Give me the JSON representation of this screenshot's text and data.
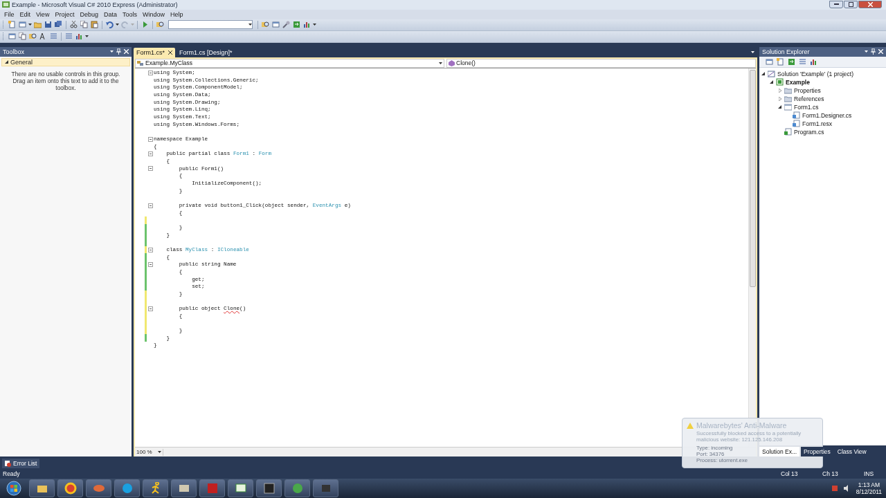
{
  "window": {
    "title": "Example - Microsoft Visual C# 2010 Express (Administrator)"
  },
  "menu": [
    "File",
    "Edit",
    "View",
    "Project",
    "Debug",
    "Data",
    "Tools",
    "Window",
    "Help"
  ],
  "toolbox": {
    "title": "Toolbox",
    "group": {
      "label": "General",
      "expanded": true
    },
    "empty_text": "There are no usable controls in this group. Drag an item onto this text to add it to the toolbox."
  },
  "editor": {
    "tabs": [
      {
        "label": "Form1.cs*",
        "selected": true
      },
      {
        "label": "Form1.cs [Design]*",
        "selected": false
      }
    ],
    "type_dropdown": "Example.MyClass",
    "member_dropdown": "Clone()",
    "zoom": "100 %",
    "lines": [
      {
        "fold": true,
        "segments": [
          {
            "text": "using System;",
            "kind": "plain"
          }
        ]
      },
      {
        "segments": [
          {
            "text": "using System.Collections.Generic;",
            "kind": "plain"
          }
        ]
      },
      {
        "segments": [
          {
            "text": "using System.ComponentModel;",
            "kind": "plain"
          }
        ]
      },
      {
        "segments": [
          {
            "text": "using System.Data;",
            "kind": "plain"
          }
        ]
      },
      {
        "segments": [
          {
            "text": "using System.Drawing;",
            "kind": "plain"
          }
        ]
      },
      {
        "segments": [
          {
            "text": "using System.Linq;",
            "kind": "plain"
          }
        ]
      },
      {
        "segments": [
          {
            "text": "using System.Text;",
            "kind": "plain"
          }
        ]
      },
      {
        "segments": [
          {
            "text": "using System.Windows.Forms;",
            "kind": "plain"
          }
        ]
      },
      {
        "fold": true,
        "blank_before": true,
        "segments": [
          {
            "text": "namespace Example",
            "kind": "plain"
          }
        ]
      },
      {
        "segments": [
          {
            "text": "{",
            "kind": "plain"
          }
        ]
      },
      {
        "fold": true,
        "segments": [
          {
            "text": "    public partial class ",
            "kind": "plain"
          },
          {
            "text": "Form1",
            "kind": "type"
          },
          {
            "text": " : ",
            "kind": "plain"
          },
          {
            "text": "Form",
            "kind": "type"
          }
        ]
      },
      {
        "segments": [
          {
            "text": "    {",
            "kind": "plain"
          }
        ]
      },
      {
        "fold": true,
        "segments": [
          {
            "text": "        public Form1()",
            "kind": "plain"
          }
        ]
      },
      {
        "segments": [
          {
            "text": "        {",
            "kind": "plain"
          }
        ]
      },
      {
        "segments": [
          {
            "text": "            InitializeComponent();",
            "kind": "plain"
          }
        ]
      },
      {
        "segments": [
          {
            "text": "        }",
            "kind": "plain"
          }
        ]
      },
      {
        "fold": true,
        "blank_before": true,
        "segments": [
          {
            "text": "        private void button1_Click(object sender, ",
            "kind": "plain"
          },
          {
            "text": "EventArgs",
            "kind": "type"
          },
          {
            "text": " e)",
            "kind": "plain"
          }
        ]
      },
      {
        "segments": [
          {
            "text": "        {",
            "kind": "plain"
          }
        ]
      },
      {
        "modified": true,
        "saved": false
      },
      {
        "modified": true,
        "saved": true,
        "segments": [
          {
            "text": "        }",
            "kind": "plain"
          }
        ]
      },
      {
        "modified": true,
        "saved": true,
        "segments": [
          {
            "text": "    }",
            "kind": "plain"
          }
        ]
      },
      {
        "modified": true,
        "saved": true
      },
      {
        "fold": true,
        "modified": true,
        "saved": false,
        "segments": [
          {
            "text": "    class ",
            "kind": "plain"
          },
          {
            "text": "MyClass",
            "kind": "type"
          },
          {
            "text": " : ",
            "kind": "plain"
          },
          {
            "text": "ICloneable",
            "kind": "type"
          }
        ]
      },
      {
        "modified": true,
        "saved": true,
        "segments": [
          {
            "text": "    {",
            "kind": "plain"
          }
        ]
      },
      {
        "fold": true,
        "modified": true,
        "saved": true,
        "segments": [
          {
            "text": "        public string Name",
            "kind": "plain"
          }
        ]
      },
      {
        "modified": true,
        "saved": true,
        "segments": [
          {
            "text": "        {",
            "kind": "plain"
          }
        ]
      },
      {
        "modified": true,
        "saved": true,
        "segments": [
          {
            "text": "            get;",
            "kind": "plain"
          }
        ]
      },
      {
        "modified": true,
        "saved": true,
        "segments": [
          {
            "text": "            set;",
            "kind": "plain"
          }
        ]
      },
      {
        "modified": true,
        "saved": false,
        "segments": [
          {
            "text": "        }",
            "kind": "plain"
          }
        ]
      },
      {
        "modified": true,
        "saved": false
      },
      {
        "fold": true,
        "modified": true,
        "saved": false,
        "segments": [
          {
            "text": "        public object ",
            "kind": "plain"
          },
          {
            "text": "Clone",
            "kind": "error"
          },
          {
            "text": "()",
            "kind": "plain"
          }
        ]
      },
      {
        "modified": true,
        "saved": false,
        "segments": [
          {
            "text": "        {",
            "kind": "plain"
          }
        ]
      },
      {
        "modified": true,
        "saved": false
      },
      {
        "modified": true,
        "saved": false,
        "segments": [
          {
            "text": "        }",
            "kind": "plain"
          }
        ]
      },
      {
        "modified": true,
        "saved": true,
        "segments": [
          {
            "text": "    }",
            "kind": "plain"
          }
        ]
      },
      {
        "segments": [
          {
            "text": "}",
            "kind": "plain"
          }
        ]
      }
    ]
  },
  "solution_explorer": {
    "title": "Solution Explorer",
    "tree": [
      {
        "label": "Solution 'Example' (1 project)",
        "kind": "solution",
        "expanded": true,
        "children": [
          {
            "label": "Example",
            "kind": "project",
            "expanded": true,
            "children": [
              {
                "label": "Properties",
                "kind": "properties",
                "expanded": false
              },
              {
                "label": "References",
                "kind": "references",
                "expanded": false
              },
              {
                "label": "Form1.cs",
                "kind": "form",
                "expanded": true,
                "children": [
                  {
                    "label": "Form1.Designer.cs",
                    "kind": "file"
                  },
                  {
                    "label": "Form1.resx",
                    "kind": "file"
                  }
                ]
              },
              {
                "label": "Program.cs",
                "kind": "code"
              }
            ]
          }
        ]
      }
    ],
    "tabs": [
      {
        "label": "Solution Ex...",
        "selected": true
      },
      {
        "label": "Properties",
        "selected": false
      },
      {
        "label": "Class View",
        "selected": false
      }
    ]
  },
  "bottom_tabs": [
    {
      "label": "Error List"
    }
  ],
  "status_bar": {
    "message": "Ready",
    "items": [
      "Col 13",
      "Ch 13",
      "INS"
    ]
  },
  "notification": {
    "title": "Malwarebytes' Anti-Malware",
    "message": "Successfully blocked access to a potentially malicious website: 121.125.146.208",
    "details": [
      "Type: incoming",
      "Port: 34376",
      "Process: utorrent.exe"
    ]
  },
  "taskbar": {
    "time": "1:13 AM",
    "date": "8/12/2011"
  }
}
